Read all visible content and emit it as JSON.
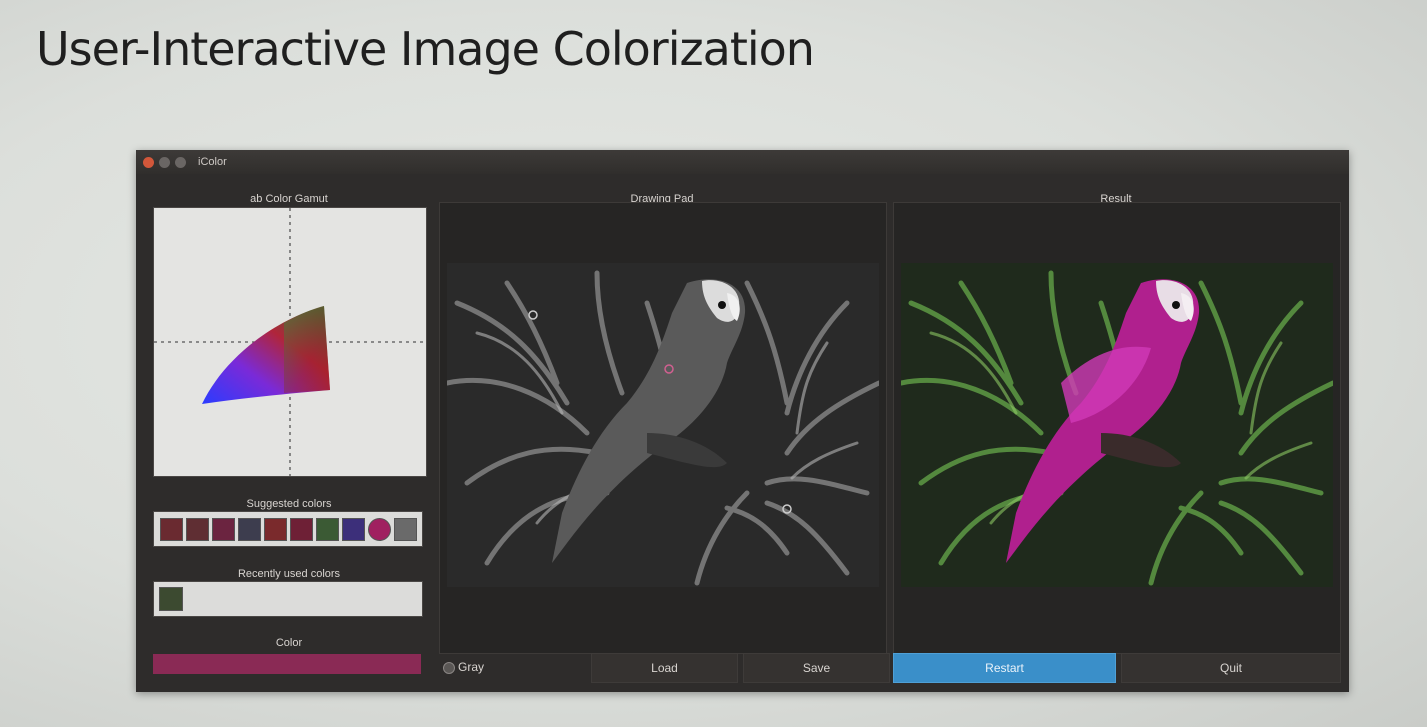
{
  "slide": {
    "title": "User-Interactive Image Colorization"
  },
  "window": {
    "title": "iColor"
  },
  "panels": {
    "gamut_label": "ab Color Gamut",
    "drawing_pad_label": "Drawing Pad",
    "result_label": "Result",
    "suggested_label": "Suggested colors",
    "recent_label": "Recently used colors",
    "color_label": "Color"
  },
  "suggested_colors": [
    "#6a2a30",
    "#5f2e33",
    "#6b2440",
    "#3d3d4e",
    "#7a2a2c",
    "#6e2036",
    "#3b5a34",
    "#3c2f7a",
    "#a02060",
    "#6a6a6a"
  ],
  "recent_colors": [
    "#3c4a30"
  ],
  "current_color": "#8a2a55",
  "controls": {
    "gray_label": "Gray",
    "load_label": "Load",
    "save_label": "Save",
    "restart_label": "Restart",
    "quit_label": "Quit"
  }
}
